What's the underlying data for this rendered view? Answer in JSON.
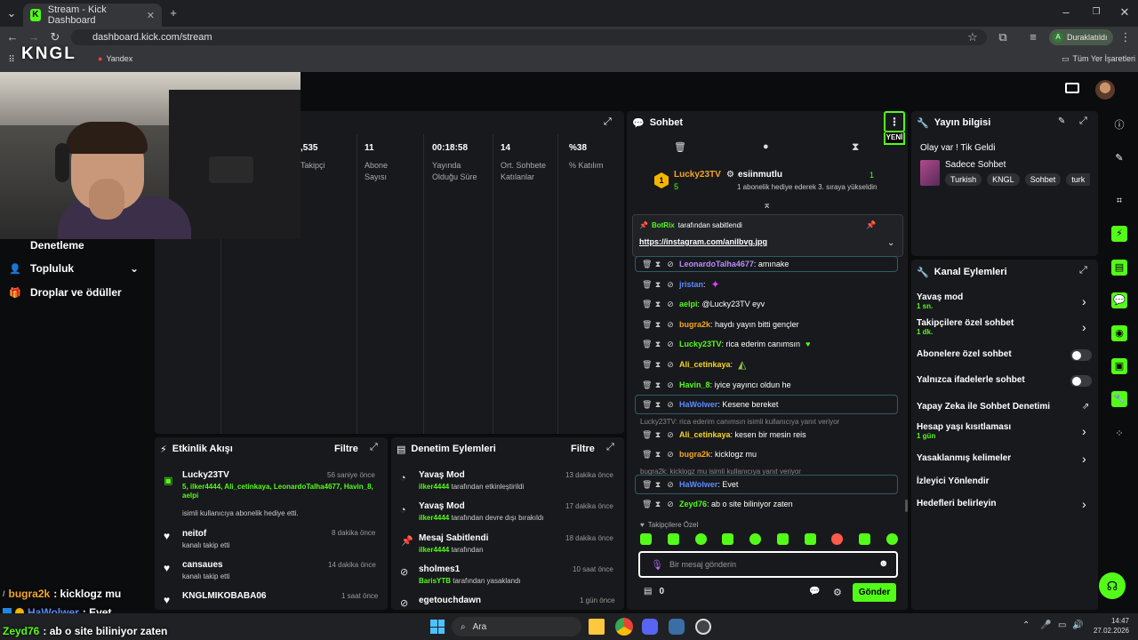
{
  "browser": {
    "tab_title": "Stream - Kick Dashboard",
    "url": "dashboard.kick.com/stream",
    "profile_label": "Duraklatıldı",
    "profile_initial": "A",
    "bookmark_1": "Yandex",
    "bookmarks_folder": "Tüm Yer İşaretleri"
  },
  "watermark": "KNGL",
  "nav": {
    "moderation": "Denetleme",
    "community": "Topluluk",
    "drops": "Droplar ve ödüller"
  },
  "stats": [
    {
      "value": ",535",
      "label": "Takipçi"
    },
    {
      "value": "11",
      "label": "Abone Sayısı"
    },
    {
      "value": "00:18:58",
      "label": "Yayında Olduğu Süre"
    },
    {
      "value": "14",
      "label": "Ort. Sohbete Katılanlar"
    },
    {
      "value": "%38",
      "label": "% Katılım"
    }
  ],
  "activity": {
    "title": "Etkinlik Akışı",
    "filter": "Filtre",
    "items": [
      {
        "name": "Lucky23TV",
        "time": "56 saniye önce",
        "detail": "5, ilker4444, Ali_cetinkaya, LeonardoTalha4677, Havin_8, aelpi",
        "sub": "isimli kullanıcıya abonelik hediye etti."
      },
      {
        "name": "neitof",
        "time": "8 dakika önce",
        "sub": "kanalı takip etti"
      },
      {
        "name": "cansaues",
        "time": "14 dakika önce",
        "sub": "kanalı takip etti"
      },
      {
        "name": "KNGLMIKOBABA06",
        "time": "1 saat önce",
        "sub": ""
      }
    ]
  },
  "modlog": {
    "title": "Denetim Eylemleri",
    "filter": "Filtre",
    "items": [
      {
        "action": "Yavaş Mod",
        "time": "13 dakika önce",
        "user": "ilker4444",
        "sub": "tarafından etkinleştirildi"
      },
      {
        "action": "Yavaş Mod",
        "time": "17 dakika önce",
        "user": "ilker4444",
        "sub": "tarafından devre dışı bırakıldı"
      },
      {
        "action": "Mesaj Sabitlendi",
        "time": "18 dakika önce",
        "user": "ilker4444",
        "sub": "tarafından"
      },
      {
        "action": "sholmes1",
        "time": "10 saat önce",
        "user": "BarisYTB",
        "sub": "tarafından yasaklandı"
      },
      {
        "action": "egetouchdawn",
        "time": "1 gün önce",
        "user": "",
        "sub": ""
      }
    ]
  },
  "chat": {
    "title": "Sohbet",
    "new_badge": "YENİ",
    "leader_1": "Lucky23TV",
    "leader_1_count": "5",
    "leader_2": "esiinmutlu",
    "leader_2_count": "1",
    "leader_2_sub": "1 abonelik hediye ederek 3. sıraya yükseldin",
    "pinned_by": "BotRix",
    "pinned_by_suffix": "tarafından sabitlendi",
    "pinned_link": "https://instagram.com/anilbvg.jpg",
    "messages": [
      {
        "user": "LeonardoTalha4677",
        "text": ": amınake",
        "color": "#b68cff"
      },
      {
        "user": "jristan",
        "text": ":",
        "color": "#5b8cff"
      },
      {
        "user": "aelpi",
        "text": ": @Lucky23TV eyv",
        "color": "#53fc18"
      },
      {
        "user": "bugra2k",
        "text": ": haydı yayın bitti gençler",
        "color": "#f5a623"
      },
      {
        "user": "Lucky23TV",
        "text": ": rica ederim canımsın",
        "color": "#53fc18"
      },
      {
        "user": "Ali_cetinkaya",
        "text": ":",
        "color": "#f5d623"
      },
      {
        "user": "Havin_8",
        "text": ": iyice yayıncı oldun he",
        "color": "#53fc18"
      },
      {
        "user": "HaWolwer",
        "text": ": Kesene bereket",
        "color": "#5b8cff"
      },
      {
        "user": "Ali_cetinkaya",
        "text": ": kesen bir mesin reis",
        "color": "#f5d623"
      },
      {
        "user": "bugra2k",
        "text": ": kicklogz mu",
        "color": "#f5a623"
      },
      {
        "user": "HaWolwer",
        "text": ": Evet",
        "color": "#5b8cff"
      },
      {
        "user": "Zeyd76",
        "text": ": ab o site biliniyor zaten",
        "color": "#53fc18"
      }
    ],
    "reply_1": "Lucky23TV: rica ederim canımsın  isimli kullanıcıya yanıt veriyor",
    "reply_2": "bugra2k: kicklogz mu isimli kullanıcıya yanıt veriyor",
    "followers_only": "Takipçilere Özel",
    "input_placeholder": "Bir mesaj gönderin",
    "points": "0",
    "send": "Gönder"
  },
  "stream_info": {
    "title": "Yayın bilgisi",
    "stream_title": "Olay var ! Tik Geldi",
    "category": "Sadece Sohbet",
    "tags": [
      "Turkish",
      "KNGL",
      "Sohbet",
      "turk"
    ]
  },
  "channel_actions": {
    "title": "Kanal Eylemleri",
    "slow_mode": "Yavaş mod",
    "slow_mode_val": "1 sn.",
    "followers_chat": "Takipçilere özel sohbet",
    "followers_chat_val": "1 dk.",
    "subs_chat": "Abonelere özel sohbet",
    "emote_chat": "Yalnızca ifadelerle sohbet",
    "ai_mod": "Yapay Zeka ile Sohbet Denetimi",
    "account_age": "Hesap yaşı kısıtlaması",
    "account_age_val": "1 gün",
    "banned_words": "Yasaklanmış kelimeler",
    "redirect": "İzleyici Yönlendir",
    "goals": "Hedefleri belirleyin"
  },
  "overlay_chat": [
    {
      "user": "bugra2k",
      "text": ": kicklogz mu",
      "color": "#f5a623"
    },
    {
      "user": "HaWolwer",
      "text": ": Evet",
      "color": "#5b8cff"
    },
    {
      "user": "Zeyd76",
      "text": ": ab o site biliniyor zaten",
      "color": "#53fc18"
    }
  ],
  "taskbar": {
    "search": "Ara",
    "time": "14:47",
    "date": "27.02.2026"
  }
}
